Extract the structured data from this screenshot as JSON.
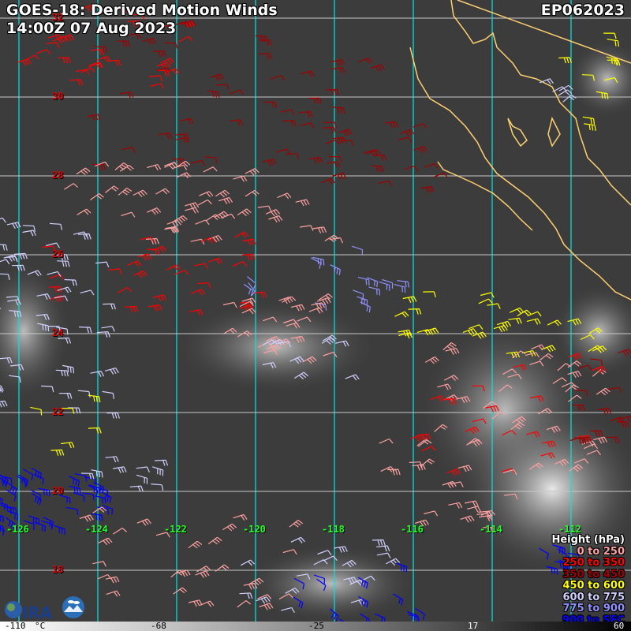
{
  "header": {
    "title": "GOES-18: Derived Motion Winds",
    "datetime": "14:00Z 07 Aug 2023",
    "storm_id": "EP062023"
  },
  "grid": {
    "latitudes": [
      "32",
      "30",
      "28",
      "26",
      "24",
      "22",
      "20",
      "18"
    ],
    "longitudes": [
      "-126",
      "-124",
      "-122",
      "-120",
      "-118",
      "-116",
      "-114",
      "-112"
    ],
    "line_color_lon": "#00e5e5",
    "line_color_lat": "#c8c8c8"
  },
  "legend": {
    "title": "Height (hPa)",
    "items": [
      {
        "label": "0 to 250",
        "color": "#ffa0a0"
      },
      {
        "label": "250 to 350",
        "color": "#ff0000"
      },
      {
        "label": "350 to 450",
        "color": "#a00000"
      },
      {
        "label": "450 to 600",
        "color": "#ffff00"
      },
      {
        "label": "600 to 775",
        "color": "#d0d0ff"
      },
      {
        "label": "775 to 900",
        "color": "#9090ff"
      },
      {
        "label": "900 to SFC",
        "color": "#0000ff"
      }
    ]
  },
  "colorbar": {
    "labels": [
      "-110",
      "°C",
      "-68",
      "-25",
      "17",
      "60"
    ]
  },
  "coastline_color": "#ffd070",
  "logos": [
    "CIRA",
    "RAMMB"
  ]
}
